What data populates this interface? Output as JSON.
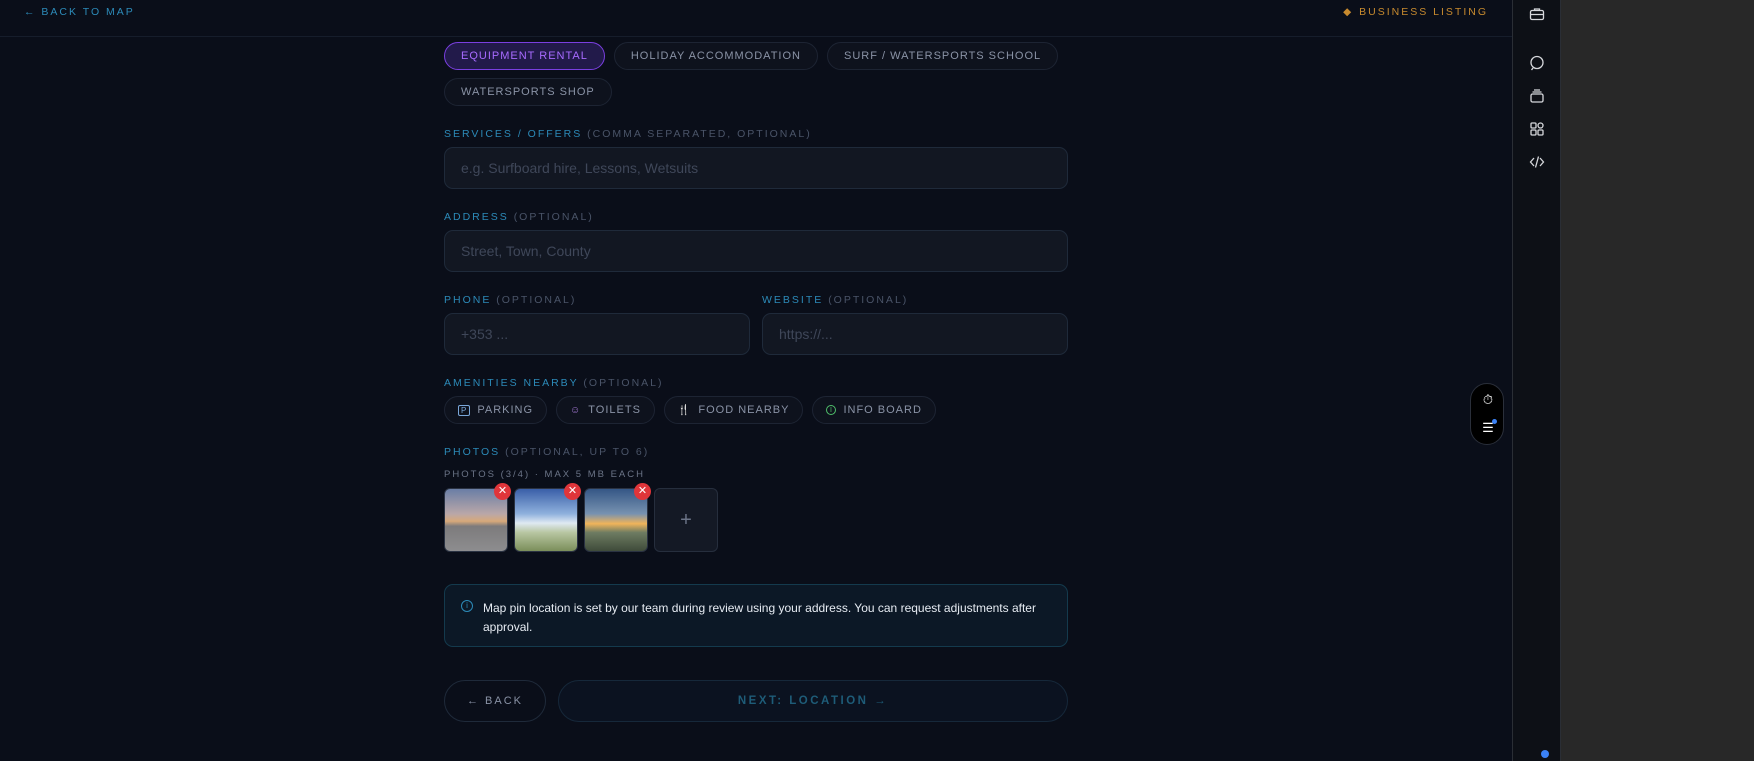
{
  "topbar": {
    "back_label": "← BACK TO MAP",
    "listing_label": "BUSINESS LISTING",
    "listing_icon": "◆"
  },
  "categories": [
    {
      "label": "EQUIPMENT RENTAL",
      "selected": true
    },
    {
      "label": "HOLIDAY ACCOMMODATION",
      "selected": false
    },
    {
      "label": "SURF / WATERSPORTS SCHOOL",
      "selected": false
    },
    {
      "label": "WATERSPORTS SHOP",
      "selected": false
    }
  ],
  "services": {
    "label": "SERVICES / OFFERS",
    "hint": "(COMMA SEPARATED, OPTIONAL)",
    "placeholder": "e.g. Surfboard hire, Lessons, Wetsuits"
  },
  "address": {
    "label": "ADDRESS",
    "hint": "(OPTIONAL)",
    "placeholder": "Street, Town, County"
  },
  "phone": {
    "label": "PHONE",
    "hint": "(OPTIONAL)",
    "placeholder": "+353 ..."
  },
  "website": {
    "label": "WEBSITE",
    "hint": "(OPTIONAL)",
    "placeholder": "https://..."
  },
  "amenities": {
    "label": "AMENITIES NEARBY",
    "hint": "(OPTIONAL)",
    "items": [
      {
        "label": "PARKING",
        "icon": "P",
        "color": "#7aa7d9"
      },
      {
        "label": "TOILETS",
        "icon": "☺",
        "color": "#a77bd9"
      },
      {
        "label": "FOOD NEARBY",
        "icon": "🍴",
        "color": "#e08a2e"
      },
      {
        "label": "INFO BOARD",
        "icon": "i",
        "color": "#4fbf6a"
      }
    ]
  },
  "photos": {
    "label": "PHOTOS",
    "hint": "(OPTIONAL, UP TO 6)",
    "count_text": "PHOTOS (3/4) · MAX 5 MB EACH",
    "remove_icon": "✕",
    "add_icon": "+"
  },
  "info": {
    "icon": "i",
    "text": "Map pin location is set by our team during review using your address. You can request adjustments after approval."
  },
  "buttons": {
    "back": "← BACK",
    "next": "NEXT: LOCATION →"
  },
  "float": {
    "timer_icon": "⏱",
    "menu_icon": "☰"
  },
  "sidebar": {
    "icons": [
      "briefcase-icon",
      "chat-icon",
      "layers-icon",
      "apps-icon",
      "code-icon"
    ]
  }
}
